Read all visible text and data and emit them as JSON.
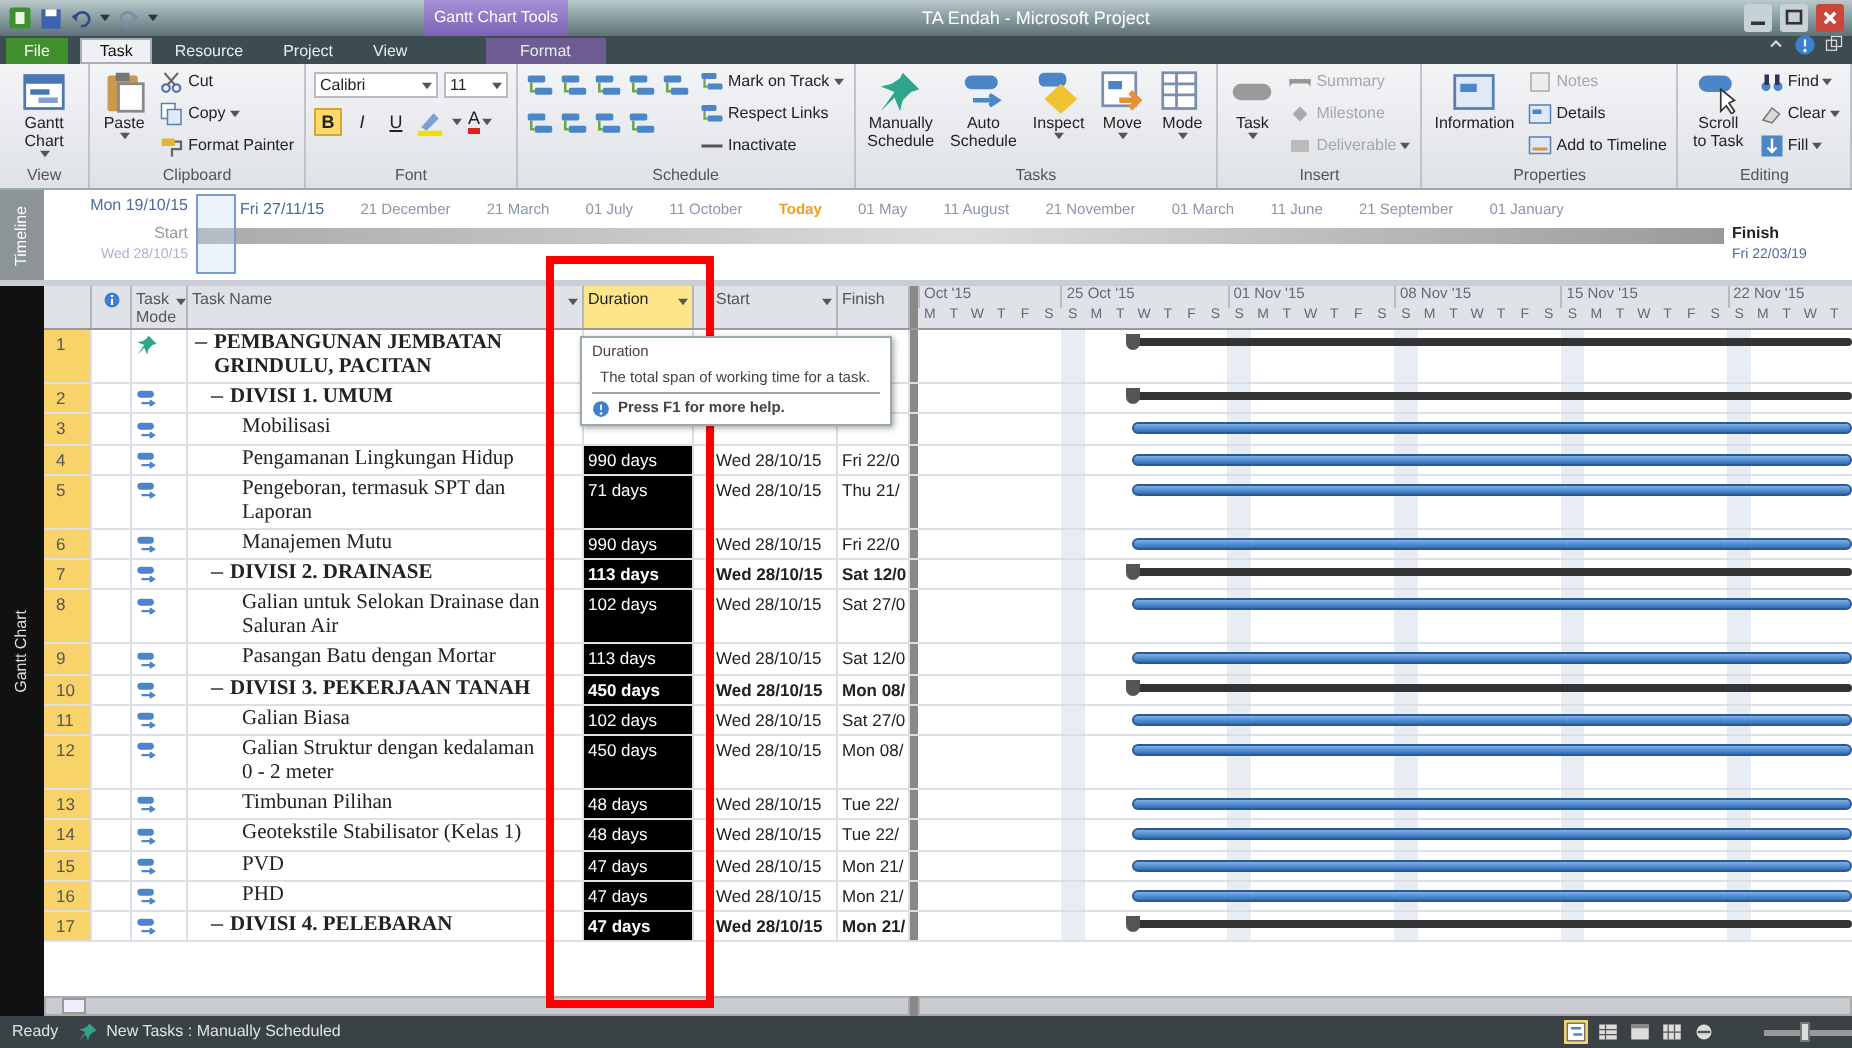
{
  "title_bar": {
    "context_label": "Gantt Chart Tools",
    "title": "TA Endah - Microsoft Project"
  },
  "tabs": [
    {
      "label": "File",
      "kind": "file",
      "selected": false
    },
    {
      "label": "Task",
      "kind": "normal",
      "selected": true
    },
    {
      "label": "Resource",
      "kind": "normal",
      "selected": false
    },
    {
      "label": "Project",
      "kind": "normal",
      "selected": false
    },
    {
      "label": "View",
      "kind": "normal",
      "selected": false
    },
    {
      "label": "Format",
      "kind": "context",
      "selected": false
    }
  ],
  "ribbon": [
    {
      "label": "View",
      "items": [
        {
          "kind": "large",
          "label": "Gantt Chart",
          "dropdown": true
        }
      ]
    },
    {
      "label": "Clipboard",
      "items": [
        {
          "kind": "large",
          "label": "Paste",
          "dropdown": true
        },
        {
          "kind": "stack",
          "items": [
            {
              "label": "Cut",
              "dropdown": false,
              "disabled": false
            },
            {
              "label": "Copy",
              "dropdown": true,
              "disabled": false
            },
            {
              "label": "Format Painter",
              "dropdown": false,
              "disabled": false
            }
          ]
        }
      ]
    },
    {
      "label": "Font",
      "items": [
        {
          "kind": "grid",
          "upper": [
            {
              "kind": "combo",
              "value": "Calibri"
            },
            {
              "kind": "combo",
              "value": "11"
            }
          ],
          "lower": [
            {
              "kind": "toggle",
              "label": "B",
              "on": true
            },
            {
              "kind": "toggle",
              "label": "I",
              "on": false
            },
            {
              "kind": "toggle",
              "label": "U",
              "on": false
            },
            {
              "kind": "icon",
              "dropdown": true
            },
            {
              "kind": "letter",
              "label": "A",
              "dropdown": true
            }
          ]
        }
      ]
    },
    {
      "label": "Schedule",
      "items": [
        {
          "kind": "grid",
          "upper": [
            {
              "kind": "icon",
              "dropdown": false
            },
            {
              "kind": "icon",
              "dropdown": false
            },
            {
              "kind": "icon",
              "dropdown": false
            },
            {
              "kind": "icon",
              "dropdown": false
            },
            {
              "kind": "icon",
              "dropdown": false
            }
          ],
          "lower": [
            {
              "kind": "icon",
              "dropdown": false
            },
            {
              "kind": "icon",
              "dropdown": false
            },
            {
              "kind": "icon",
              "dropdown": false
            },
            {
              "kind": "icon",
              "dropdown": false
            }
          ]
        },
        {
          "kind": "stack",
          "items": [
            {
              "label": "Mark on Track",
              "dropdown": true,
              "disabled": false
            },
            {
              "label": "Respect Links",
              "dropdown": false,
              "disabled": false
            },
            {
              "label": "Inactivate",
              "dropdown": false,
              "disabled": false
            }
          ]
        }
      ]
    },
    {
      "label": "Tasks",
      "items": [
        {
          "kind": "large",
          "label": "Manually Schedule",
          "dropdown": false
        },
        {
          "kind": "large",
          "label": "Auto Schedule",
          "dropdown": false
        },
        {
          "kind": "large",
          "label": "Inspect",
          "dropdown": true
        },
        {
          "kind": "large",
          "label": "Move",
          "dropdown": true
        },
        {
          "kind": "large",
          "label": "Mode",
          "dropdown": true
        }
      ]
    },
    {
      "label": "Insert",
      "items": [
        {
          "kind": "large",
          "label": "Task",
          "dropdown": true
        },
        {
          "kind": "stack",
          "items": [
            {
              "label": "Summary",
              "dropdown": false,
              "disabled": true
            },
            {
              "label": "Milestone",
              "dropdown": false,
              "disabled": true
            },
            {
              "label": "Deliverable",
              "dropdown": true,
              "disabled": true
            }
          ]
        }
      ]
    },
    {
      "label": "Properties",
      "items": [
        {
          "kind": "large",
          "label": "Information",
          "dropdown": false
        },
        {
          "kind": "stack",
          "items": [
            {
              "label": "Notes",
              "dropdown": false,
              "disabled": true
            },
            {
              "label": "Details",
              "dropdown": false,
              "disabled": false
            },
            {
              "label": "Add to Timeline",
              "dropdown": false,
              "disabled": false
            }
          ]
        }
      ]
    },
    {
      "label": "Editing",
      "items": [
        {
          "kind": "large",
          "label": "Scroll to Task",
          "dropdown": false
        },
        {
          "kind": "stack",
          "items": [
            {
              "label": "Find",
              "dropdown": true,
              "disabled": false
            },
            {
              "label": "Clear",
              "dropdown": true,
              "disabled": false
            },
            {
              "label": "Fill",
              "dropdown": true,
              "disabled": false
            }
          ]
        }
      ]
    }
  ],
  "timeline": {
    "label": "Timeline",
    "view_start": "Mon 19/10/15",
    "view_end": "Fri 27/11/15",
    "scale": [
      {
        "text": "21 December",
        "kind": "date"
      },
      {
        "text": "21 March",
        "kind": "date"
      },
      {
        "text": "01 July",
        "kind": "date"
      },
      {
        "text": "11 October",
        "kind": "date"
      },
      {
        "text": "Today",
        "kind": "today"
      },
      {
        "text": "01 May",
        "kind": "date"
      },
      {
        "text": "11 August",
        "kind": "date"
      },
      {
        "text": "21 November",
        "kind": "date"
      },
      {
        "text": "01 March",
        "kind": "date"
      },
      {
        "text": "11 June",
        "kind": "date"
      },
      {
        "text": "21 September",
        "kind": "date"
      },
      {
        "text": "01 January",
        "kind": "date"
      }
    ],
    "start_label": "Start",
    "start_date": "Wed 28/10/15",
    "finish_label": "Finish",
    "finish_date": "Fri 22/03/19"
  },
  "side_label": "Gantt Chart",
  "columns": [
    {
      "label": "Task Mode",
      "dropdown": true,
      "selected": false
    },
    {
      "label": "Task Name",
      "dropdown": true,
      "selected": false
    },
    {
      "label": "Duration",
      "dropdown": true,
      "selected": true
    },
    {
      "label": "Start",
      "dropdown": true,
      "selected": false
    },
    {
      "label": "Finish",
      "dropdown": false,
      "selected": false
    }
  ],
  "tasks": [
    {
      "id": "1",
      "manual": true,
      "kind": "summary",
      "name": "PEMBANGUNAN JEMBATAN GRINDULU, PACITAN",
      "children": [
        {
          "id": "2",
          "manual": false,
          "kind": "summary",
          "name": "DIVISI 1. UMUM",
          "children": [
            {
              "id": "3",
              "manual": false,
              "kind": "task",
              "name": "Mobilisasi"
            },
            {
              "id": "4",
              "manual": false,
              "kind": "task",
              "name": "Pengamanan Lingkungan Hidup",
              "duration": "990 days",
              "start": "Wed 28/10/15",
              "finish": "Fri 22/0"
            },
            {
              "id": "5",
              "manual": false,
              "kind": "task",
              "name": "Pengeboran, termasuk SPT dan Laporan",
              "duration": "71 days",
              "start": "Wed 28/10/15",
              "finish": "Thu 21/"
            },
            {
              "id": "6",
              "manual": false,
              "kind": "task",
              "name": "Manajemen Mutu",
              "duration": "990 days",
              "start": "Wed 28/10/15",
              "finish": "Fri 22/0"
            }
          ]
        },
        {
          "id": "7",
          "manual": false,
          "kind": "summary",
          "name": "DIVISI 2. DRAINASE",
          "duration": "113 days",
          "start": "Wed 28/10/15",
          "finish": "Sat 12/0",
          "children": [
            {
              "id": "8",
              "manual": false,
              "kind": "task",
              "name": "Galian untuk Selokan Drainase dan Saluran Air",
              "duration": "102 days",
              "start": "Wed 28/10/15",
              "finish": "Sat 27/0"
            },
            {
              "id": "9",
              "manual": false,
              "kind": "task",
              "name": "Pasangan Batu dengan Mortar",
              "duration": "113 days",
              "start": "Wed 28/10/15",
              "finish": "Sat 12/0"
            }
          ]
        },
        {
          "id": "10",
          "manual": false,
          "kind": "summary",
          "name": "DIVISI 3. PEKERJAAN TANAH",
          "duration": "450 days",
          "start": "Wed 28/10/15",
          "finish": "Mon 08/",
          "children": [
            {
              "id": "11",
              "manual": false,
              "kind": "task",
              "name": "Galian Biasa",
              "duration": "102 days",
              "start": "Wed 28/10/15",
              "finish": "Sat 27/0"
            },
            {
              "id": "12",
              "manual": false,
              "kind": "task",
              "name": "Galian Struktur dengan kedalaman 0 - 2 meter",
              "duration": "450 days",
              "start": "Wed 28/10/15",
              "finish": "Mon 08/"
            },
            {
              "id": "13",
              "manual": false,
              "kind": "task",
              "name": "Timbunan Pilihan",
              "duration": "48 days",
              "start": "Wed 28/10/15",
              "finish": "Tue 22/"
            },
            {
              "id": "14",
              "manual": false,
              "kind": "task",
              "name": "Geotekstile Stabilisator (Kelas 1)",
              "duration": "48 days",
              "start": "Wed 28/10/15",
              "finish": "Tue 22/"
            },
            {
              "id": "15",
              "manual": false,
              "kind": "task",
              "name": "PVD",
              "duration": "47 days",
              "start": "Wed 28/10/15",
              "finish": "Mon 21/"
            },
            {
              "id": "16",
              "manual": false,
              "kind": "task",
              "name": "PHD",
              "duration": "47 days",
              "start": "Wed 28/10/15",
              "finish": "Mon 21/"
            }
          ]
        },
        {
          "id": "17",
          "manual": false,
          "kind": "summary",
          "name": "DIVISI 4. PELEBARAN",
          "duration": "47 days",
          "start": "Wed 28/10/15",
          "finish": "Mon 21/"
        }
      ]
    }
  ],
  "gantt": {
    "weeks": [
      {
        "label": "Oct '15",
        "days": [
          "M",
          "T",
          "W",
          "T",
          "F",
          "S"
        ]
      },
      {
        "label": "25 Oct '15",
        "days": [
          "S",
          "M",
          "T",
          "W",
          "T",
          "F",
          "S"
        ]
      },
      {
        "label": "01 Nov '15",
        "days": [
          "S",
          "M",
          "T",
          "W",
          "T",
          "F",
          "S"
        ]
      },
      {
        "label": "08 Nov '15",
        "days": [
          "S",
          "M",
          "T",
          "W",
          "T",
          "F",
          "S"
        ]
      },
      {
        "label": "15 Nov '15",
        "days": [
          "S",
          "M",
          "T",
          "W",
          "T",
          "F",
          "S"
        ]
      },
      {
        "label": "22 Nov '15",
        "days": [
          "S",
          "M",
          "T",
          "W",
          "T"
        ]
      }
    ]
  },
  "tooltip": {
    "title": "Duration",
    "text": "The total span of working time for a task.",
    "help": "Press F1 for more help."
  },
  "status_bar": {
    "status": "Ready",
    "task_mode": "New Tasks : Manually Scheduled",
    "views": [
      {
        "selected": true
      },
      {
        "selected": false
      },
      {
        "selected": false
      },
      {
        "selected": false
      },
      {
        "selected": false
      }
    ],
    "zoom": {
      "level": 0.4
    }
  }
}
